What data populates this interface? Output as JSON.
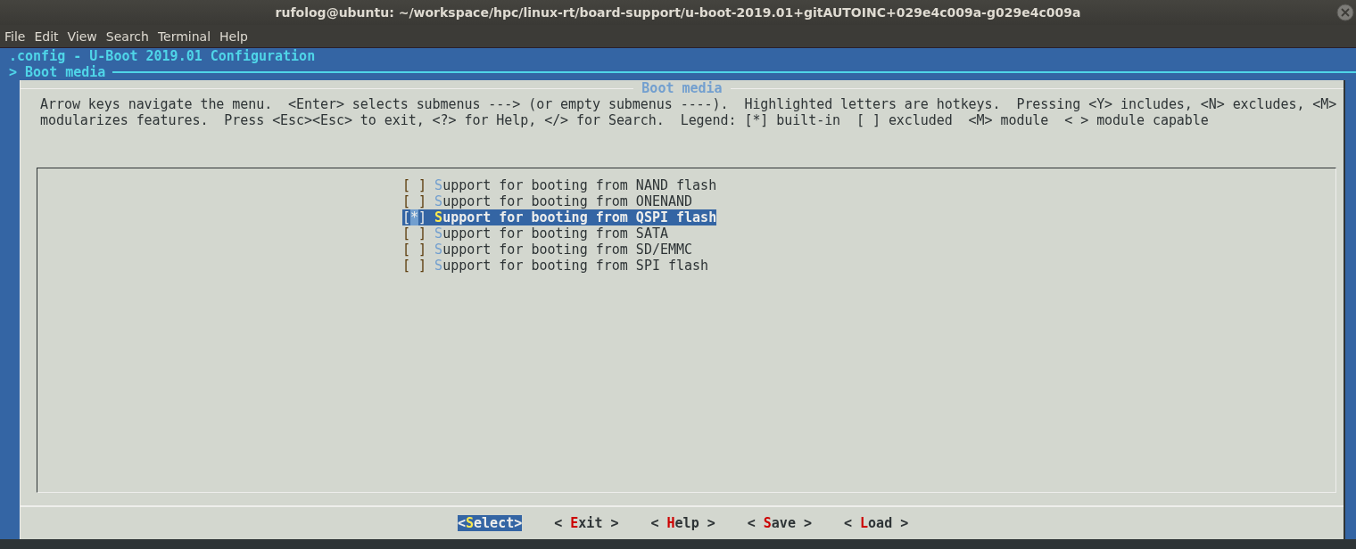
{
  "window": {
    "title": "rufolog@ubuntu: ~/workspace/hpc/linux-rt/board-support/u-boot-2019.01+gitAUTOINC+029e4c009a-g029e4c009a"
  },
  "menu_bar": [
    "File",
    "Edit",
    "View",
    "Search",
    "Terminal",
    "Help"
  ],
  "terminal": {
    "header": ".config - U-Boot 2019.01 Configuration",
    "breadcrumb": "> Boot media",
    "dialog": {
      "title": "Boot media",
      "help_lines": [
        "Arrow keys navigate the menu.  <Enter> selects submenus ---> (or empty submenus ----).  Highlighted letters are hotkeys.  Pressing <Y> includes, <N> excludes, <M>",
        "modularizes features.  Press <Esc><Esc> to exit, <?> for Help, </> for Search.  Legend: [*] built-in  [ ] excluded  <M> module  < > module capable"
      ],
      "items": [
        {
          "open": "[",
          "checked": false,
          "close": "]",
          "label": "Support for booting from NAND flash",
          "selected": false
        },
        {
          "open": "[",
          "checked": false,
          "close": "]",
          "label": "Support for booting from ONENAND",
          "selected": false
        },
        {
          "open": "[",
          "checked": true,
          "mark": "*",
          "close": "]",
          "label": "Support for booting from QSPI flash",
          "selected": true
        },
        {
          "open": "[",
          "checked": false,
          "close": "]",
          "label": "Support for booting from SATA",
          "selected": false
        },
        {
          "open": "[",
          "checked": false,
          "close": "]",
          "label": "Support for booting from SD/EMMC",
          "selected": false
        },
        {
          "open": "[",
          "checked": false,
          "close": "]",
          "label": "Support for booting from SPI flash",
          "selected": false
        }
      ],
      "buttons": [
        {
          "open": "<",
          "label": "Select",
          "close": ">",
          "selected": true
        },
        {
          "open": "< ",
          "label": "Exit",
          "close": " >",
          "selected": false
        },
        {
          "open": "< ",
          "label": "Help",
          "close": " >",
          "selected": false
        },
        {
          "open": "< ",
          "label": "Save",
          "close": " >",
          "selected": false
        },
        {
          "open": "< ",
          "label": "Load",
          "close": " >",
          "selected": false
        }
      ]
    }
  }
}
